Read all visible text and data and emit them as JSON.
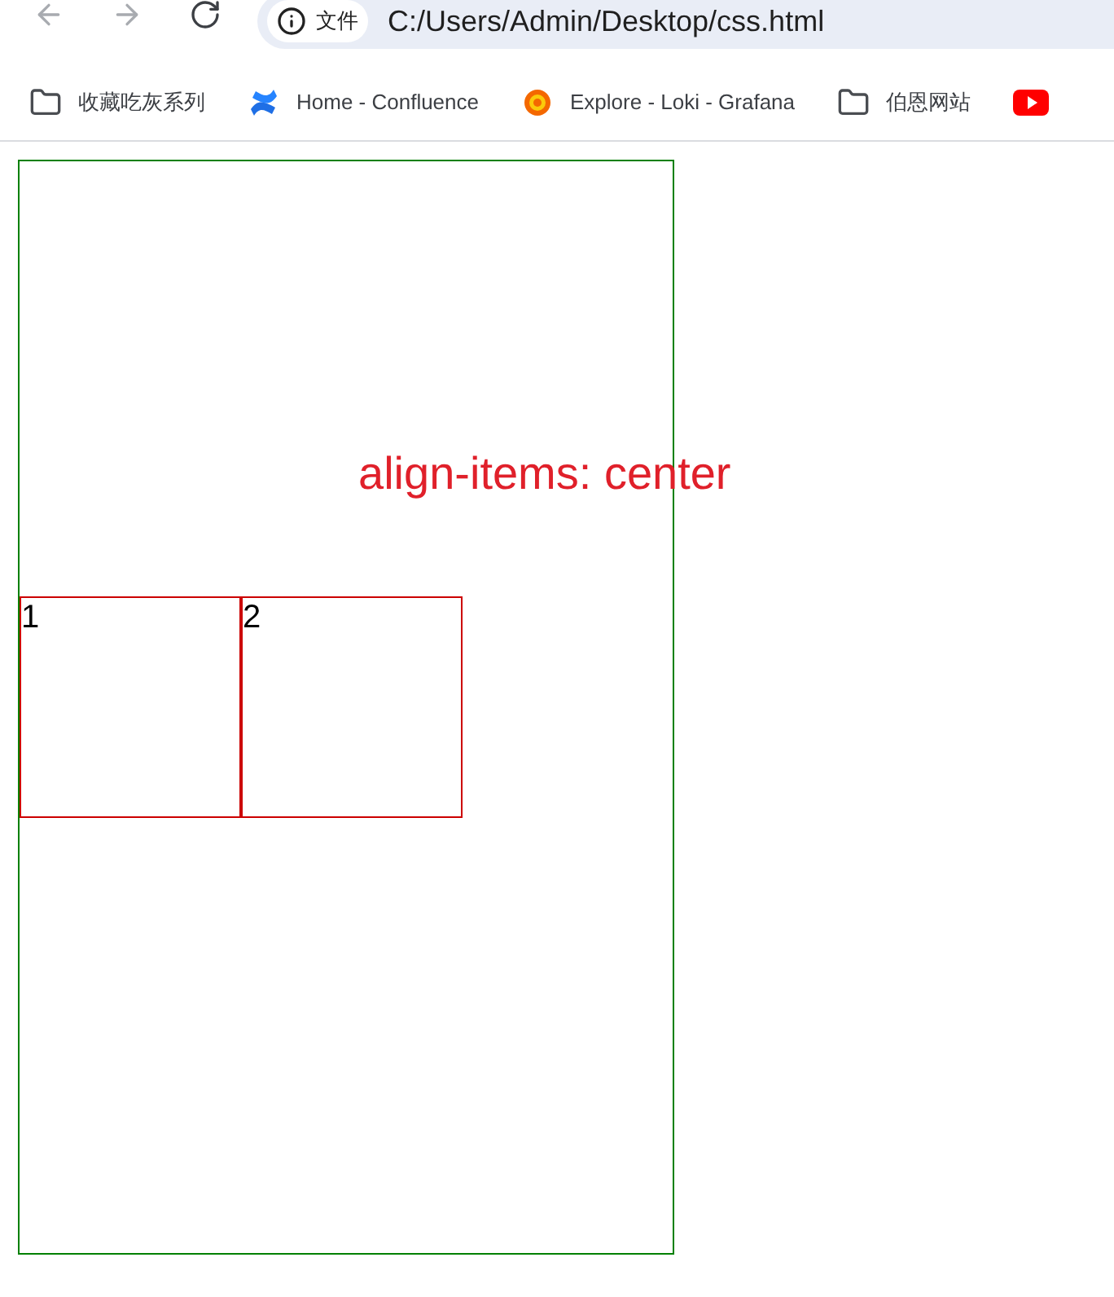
{
  "toolbar": {
    "nav_buttons": [
      {
        "kind": "back",
        "disabled": true
      },
      {
        "kind": "forward",
        "disabled": true
      },
      {
        "kind": "reload",
        "disabled": false
      }
    ],
    "security_chip": "文件",
    "url": "C:/Users/Admin/Desktop/css.html"
  },
  "bookmarks": [
    {
      "kind": "folder",
      "label": "收藏吃灰系列"
    },
    {
      "kind": "confluence",
      "label": "Home - Confluence"
    },
    {
      "kind": "grafana",
      "label": "Explore - Loki - Grafana"
    },
    {
      "kind": "folder",
      "label": "伯恩网站"
    },
    {
      "kind": "youtube"
    }
  ],
  "page": {
    "heading": "align-items: center",
    "items": [
      "1",
      "2"
    ]
  }
}
